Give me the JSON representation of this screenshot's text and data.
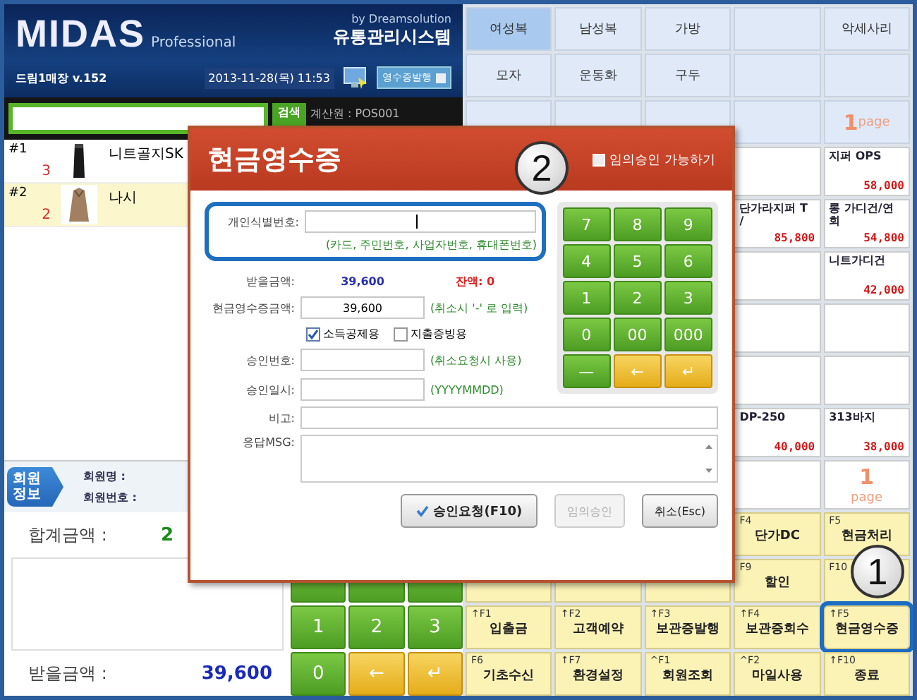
{
  "header": {
    "logo": "MIDAS",
    "logo_sub": "Professional",
    "vendor": "by Dreamsolution",
    "system": "유통관리시스템",
    "store": "드림1매장 v.152",
    "datetime": "2013-11-28(목) 11:53",
    "receipt_button": "영수증발행"
  },
  "search": {
    "button": "검색",
    "cashier": "계산원 : POS001"
  },
  "items": [
    {
      "no": "#1",
      "name": "니트골지SK",
      "qty": "3",
      "selected": false
    },
    {
      "no": "#2",
      "name": "나시",
      "qty": "2",
      "selected": true
    }
  ],
  "member": {
    "tab": "회원 정보",
    "name_label": "회원명 :",
    "number_label": "회원번호 :"
  },
  "summary": {
    "total_label": "합계금액 :",
    "total": "2",
    "due_label": "받을금액 :",
    "due": "39,600"
  },
  "keypad": [
    {
      "label": "1",
      "kind": "digit"
    },
    {
      "label": "2",
      "kind": "digit"
    },
    {
      "label": "3",
      "kind": "digit"
    },
    {
      "label": "0",
      "kind": "digit"
    },
    {
      "label": "←",
      "kind": "back"
    },
    {
      "label": "↵",
      "kind": "enter"
    }
  ],
  "categories": [
    {
      "kind": "category",
      "label": "여성복",
      "selected": true
    },
    {
      "kind": "category",
      "label": "남성복",
      "selected": false
    },
    {
      "kind": "category",
      "label": "가방",
      "selected": false
    },
    {
      "kind": "empty"
    },
    {
      "kind": "category",
      "label": "악세사리",
      "selected": false
    },
    {
      "kind": "category",
      "label": "모자",
      "selected": false
    },
    {
      "kind": "category",
      "label": "운동화",
      "selected": false
    },
    {
      "kind": "category",
      "label": "구두",
      "selected": false
    },
    {
      "kind": "empty"
    },
    {
      "kind": "empty"
    },
    {
      "kind": "empty"
    },
    {
      "kind": "empty"
    },
    {
      "kind": "empty"
    },
    {
      "kind": "empty"
    },
    {
      "kind": "page",
      "number": "1",
      "unit": "page"
    }
  ],
  "products": [
    {
      "kind": "empty"
    },
    {
      "kind": "product",
      "name": "지퍼 OPS",
      "price": "58,000"
    },
    {
      "kind": "product",
      "name": "단가라지퍼 T /",
      "price": "85,800"
    },
    {
      "kind": "product",
      "name": "롱 가디건/연회",
      "price": "54,800"
    },
    {
      "kind": "empty"
    },
    {
      "kind": "product",
      "name": "니트가디건",
      "price": "42,000"
    },
    {
      "kind": "empty"
    },
    {
      "kind": "empty"
    },
    {
      "kind": "empty"
    },
    {
      "kind": "empty"
    },
    {
      "kind": "product",
      "name": "DP-250",
      "price": "40,000"
    },
    {
      "kind": "product",
      "name": "313바지",
      "price": "38,000"
    },
    {
      "kind": "empty"
    },
    {
      "kind": "page",
      "number": "1",
      "unit": "page"
    }
  ],
  "function_keys": [
    {
      "kind": "hidden"
    },
    {
      "kind": "hidden"
    },
    {
      "kind": "hidden"
    },
    {
      "kind": "fkey",
      "key": "F4",
      "label": "단가DC",
      "highlighted": false
    },
    {
      "kind": "fkey",
      "key": "F5",
      "label": "현금처리",
      "highlighted": false
    },
    {
      "kind": "blank"
    },
    {
      "kind": "blank"
    },
    {
      "kind": "blank"
    },
    {
      "kind": "fkey",
      "key": "F9",
      "label": "할인",
      "highlighted": false
    },
    {
      "kind": "fkey",
      "key": "F10",
      "highlighted": false
    },
    {
      "kind": "fkey",
      "key": "↑F1",
      "label": "입출금",
      "highlighted": false
    },
    {
      "kind": "fkey",
      "key": "↑F2",
      "label": "고객예약",
      "highlighted": false
    },
    {
      "kind": "fkey",
      "key": "↑F3",
      "label": "보관증발행",
      "highlighted": false
    },
    {
      "kind": "fkey",
      "key": "↑F4",
      "label": "보관증회수",
      "highlighted": false
    },
    {
      "kind": "fkey",
      "key": "↑F5",
      "label": "현금영수증",
      "highlighted": true
    },
    {
      "kind": "fkey",
      "key": "F6",
      "label": "기초수신",
      "highlighted": false
    },
    {
      "kind": "fkey",
      "key": "↑F7",
      "label": "환경설정",
      "highlighted": false
    },
    {
      "kind": "fkey",
      "key": "^F1",
      "label": "회원조회",
      "highlighted": false
    },
    {
      "kind": "fkey",
      "key": "^F2",
      "label": "마일사용",
      "highlighted": false
    },
    {
      "kind": "fkey",
      "key": "↑F10",
      "label": "종료",
      "highlighted": false
    }
  ],
  "dialog": {
    "title": "현금영수증",
    "arbitrary_approval": {
      "label": "임의승인 가능하기",
      "checked": false
    },
    "id_label": "개인식별번호:",
    "id_hint": "(카드, 주민번호, 사업자번호, 휴대폰번호)",
    "due_label": "받을금액:",
    "due": "39,600",
    "balance": "잔액: 0",
    "amount_label": "현금영수증금액:",
    "amount": "39,600",
    "amount_hint": "(취소시 '-' 로 입력)",
    "options": [
      {
        "label": "소득공제용",
        "checked": true
      },
      {
        "label": "지출증빙용",
        "checked": false
      }
    ],
    "approval_no_label": "승인번호:",
    "approval_no_hint": "(취소요청시 사용)",
    "approval_date_label": "승인일시:",
    "approval_date_hint": "(YYYYMMDD)",
    "memo_label": "비고:",
    "response_label": "응답MSG:",
    "keypad": [
      {
        "label": "7",
        "kind": "digit"
      },
      {
        "label": "8",
        "kind": "digit"
      },
      {
        "label": "9",
        "kind": "digit"
      },
      {
        "label": "4",
        "kind": "digit"
      },
      {
        "label": "5",
        "kind": "digit"
      },
      {
        "label": "6",
        "kind": "digit"
      },
      {
        "label": "1",
        "kind": "digit"
      },
      {
        "label": "2",
        "kind": "digit"
      },
      {
        "label": "3",
        "kind": "digit"
      },
      {
        "label": "0",
        "kind": "digit"
      },
      {
        "label": "00",
        "kind": "digit"
      },
      {
        "label": "000",
        "kind": "digit"
      },
      {
        "label": "—",
        "kind": "digit"
      },
      {
        "label": "←",
        "kind": "back"
      },
      {
        "label": "↵",
        "kind": "enter"
      }
    ],
    "buttons": [
      {
        "label": "승인요청(F10)",
        "kind": "primary",
        "disabled": false
      },
      {
        "label": "임의승인",
        "kind": "plain",
        "disabled": true
      },
      {
        "label": "취소(Esc)",
        "kind": "plain",
        "disabled": false
      }
    ]
  },
  "callouts": [
    {
      "label": "1"
    },
    {
      "label": "2"
    }
  ]
}
